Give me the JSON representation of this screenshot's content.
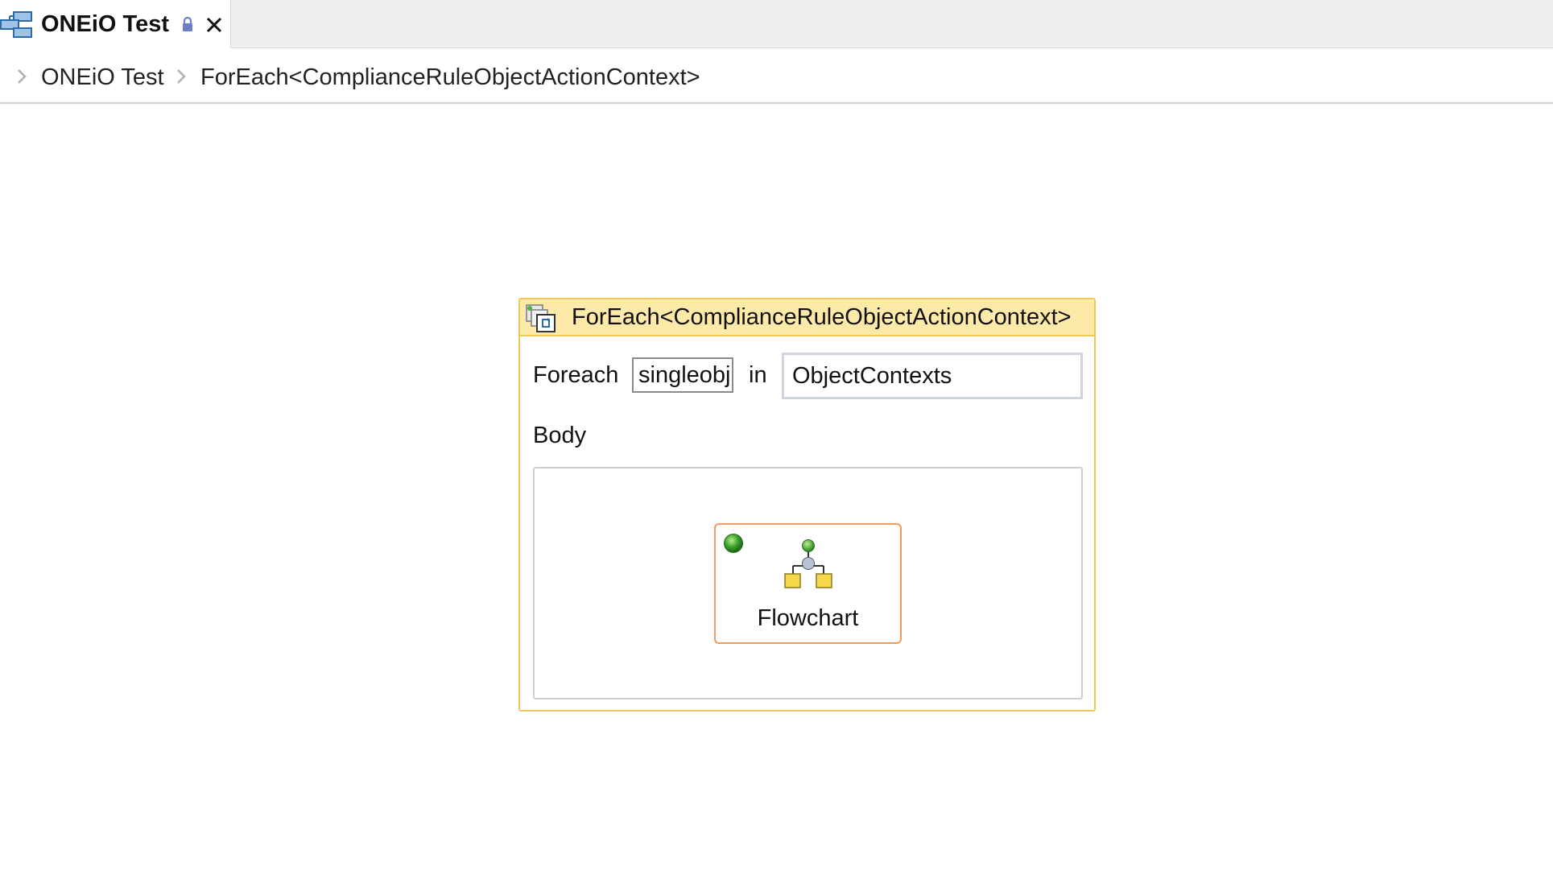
{
  "tab": {
    "title": "ONEiO Test",
    "icon": "workflow-icon",
    "lock_icon": "lock-icon",
    "close_icon": "close-icon"
  },
  "breadcrumb": {
    "items": [
      {
        "label": "ONEiO Test"
      },
      {
        "label": "ForEach<ComplianceRuleObjectActionContext>"
      }
    ]
  },
  "activity": {
    "title": "ForEach<ComplianceRuleObjectActionContext>",
    "icon": "foreach-icon",
    "foreach_label": "Foreach",
    "variable_value": "singleobj",
    "in_label": "in",
    "collection_value": "ObjectContexts",
    "body_label": "Body",
    "child": {
      "label": "Flowchart",
      "icon": "flowchart-icon",
      "start_icon": "start-node-icon"
    }
  },
  "colors": {
    "header_fill": "#fde9a8",
    "header_border": "#f0c858",
    "flowchart_border": "#f29a5a"
  }
}
